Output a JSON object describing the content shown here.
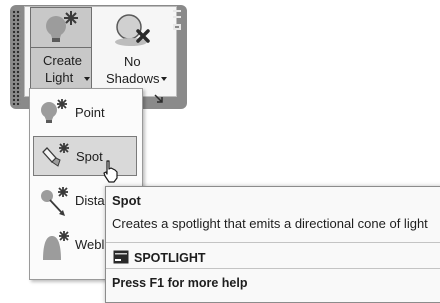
{
  "ribbon": {
    "create_light": {
      "line1": "Create",
      "line2": "Light"
    },
    "no_shadows": {
      "line1": "No",
      "line2": "Shadows"
    }
  },
  "menu": {
    "items": [
      {
        "label": "Point"
      },
      {
        "label": "Spot"
      },
      {
        "label": "Dista"
      },
      {
        "label": "Webl"
      }
    ],
    "highlighted_item": "Spot"
  },
  "tooltip": {
    "title": "Spot",
    "description": "Creates a spotlight that emits a directional cone of light",
    "command": "SPOTLIGHT",
    "help": "Press F1 for more help"
  },
  "icons": [
    "grip-icon",
    "create-light-icon",
    "no-shadows-icon",
    "point-light-icon",
    "spot-light-icon",
    "distant-light-icon",
    "web-light-icon",
    "command-icon",
    "mouse-cursor-icon"
  ],
  "colors": {
    "panel": "#8a8a8a",
    "highlight": "#d9d9d9",
    "tooltip_bg": "#f9f9f9"
  }
}
